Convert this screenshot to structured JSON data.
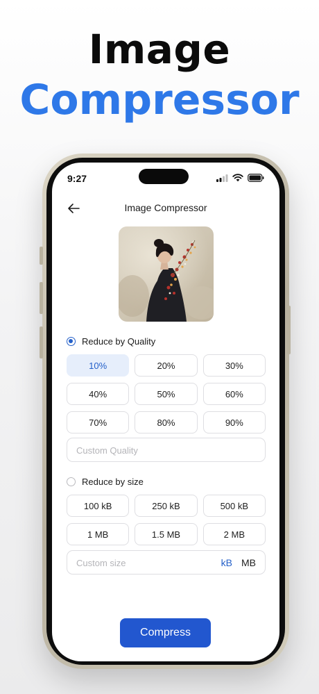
{
  "promo": {
    "line1": "Image",
    "line2": "Compressor"
  },
  "status_bar": {
    "time": "9:27"
  },
  "header": {
    "title": "Image Compressor"
  },
  "quality": {
    "label": "Reduce by Quality",
    "selected": true,
    "options": [
      "10%",
      "20%",
      "30%",
      "40%",
      "50%",
      "60%",
      "70%",
      "80%",
      "90%"
    ],
    "selected_option": "10%",
    "custom_placeholder": "Custom Quality"
  },
  "size": {
    "label": "Reduce by size",
    "selected": false,
    "options": [
      "100 kB",
      "250 kB",
      "500 kB",
      "1 MB",
      "1.5 MB",
      "2 MB"
    ],
    "custom_placeholder": "Custom size",
    "units": [
      "kB",
      "MB"
    ],
    "selected_unit": "kB"
  },
  "actions": {
    "compress_label": "Compress"
  },
  "colors": {
    "accent": "#2460c9",
    "brand_blue": "#2e78e8",
    "button": "#2257cf"
  }
}
